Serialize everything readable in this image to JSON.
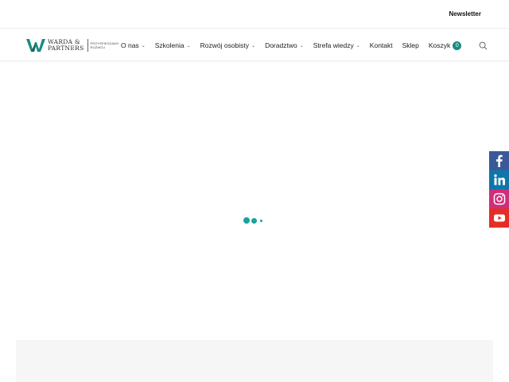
{
  "topbar": {
    "newsletter_label": "Newsletter"
  },
  "logo": {
    "line1": "WARDA &",
    "line2": "PARTNERS",
    "tag1": "PRZYSPIESZAMY",
    "tag2": "ROZWÓJ"
  },
  "nav": {
    "items": [
      {
        "label": "O nas",
        "has_dropdown": true
      },
      {
        "label": "Szkolenia",
        "has_dropdown": true
      },
      {
        "label": "Rozwój osobisty",
        "has_dropdown": true
      },
      {
        "label": "Doradztwo",
        "has_dropdown": true
      },
      {
        "label": "Strefa wiedzy",
        "has_dropdown": true
      },
      {
        "label": "Kontakt",
        "has_dropdown": false
      },
      {
        "label": "Sklep",
        "has_dropdown": false
      }
    ],
    "cart_label": "Koszyk",
    "cart_count": "0"
  },
  "social": [
    "facebook-icon",
    "linkedin-icon",
    "instagram-icon",
    "youtube-icon"
  ],
  "colors": {
    "accent": "#1a8a82",
    "loader": "#1aa39a",
    "facebook": "#3b5998",
    "linkedin": "#0e76a8",
    "instagram": "#cf2e7a",
    "youtube": "#e52d27"
  }
}
